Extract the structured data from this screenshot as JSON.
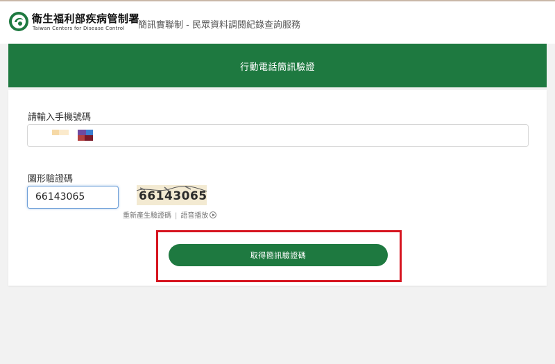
{
  "header": {
    "org_name_zh": "衛生福利部疾病管制署",
    "org_name_en": "Taiwan Centers for Disease Control",
    "service_title": "簡訊實聯制 - 民眾資料調閱紀錄查詢服務"
  },
  "banner": {
    "title": "行動電話簡訊驗證"
  },
  "form": {
    "phone_label": "請輸入手機號碼",
    "phone_value": "",
    "captcha_label": "圖形驗證碼",
    "captcha_value": "66143065",
    "captcha_image_text": "66143065",
    "regenerate_link": "重新產生驗證碼",
    "separator": "|",
    "audio_link": "語音播放",
    "submit_label": "取得簡訊驗證碼"
  },
  "icons": {
    "logo": "cdc-logo-icon",
    "audio": "play-circle-icon"
  },
  "colors": {
    "brand_green": "#1e7940",
    "highlight_red": "#d6141f"
  }
}
